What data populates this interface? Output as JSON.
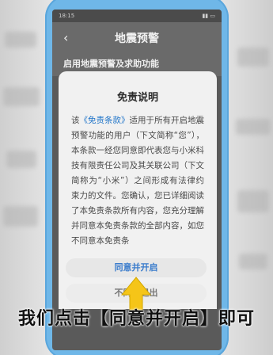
{
  "statusbar": {
    "time": "18:15",
    "icons": "battery-signal-icons"
  },
  "header": {
    "title": "地震预警"
  },
  "section": {
    "title": "启用地震预警及求助功能"
  },
  "dialog": {
    "title": "免责说明",
    "body_prefix": "该",
    "terms_link": "《免责条款》",
    "body": "适用于所有开启地震预警功能的用户（下文简称“您”），本条款一经您同意即代表您与小米科技有限责任公司及其关联公司（下文简称为“小米”）之间形成有法律约束力的文件。您确认，您已详细阅读了本免责条款所有内容，您充分理解并同意本免责条款的全部内容，如您不同意本免责条",
    "agree_label": "同意并开启",
    "exit_label": "不同意退出"
  },
  "caption": {
    "text": "我们点击【同意并开启】即可"
  },
  "colors": {
    "phone_frame": "#6fb7e8",
    "link": "#1e74c9",
    "arrow": "#f5c518"
  }
}
